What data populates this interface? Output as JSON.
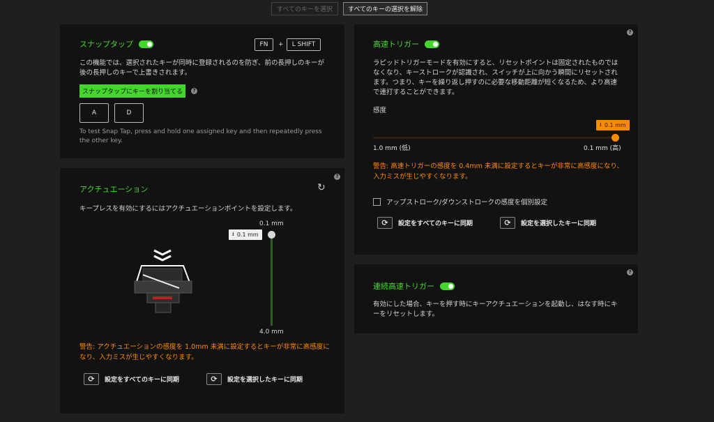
{
  "top": {
    "select_all": "すべてのキーを選択",
    "deselect_all": "すべてのキーの選択を解除"
  },
  "snap_tap": {
    "title": "スナップタップ",
    "key_fn": "FN",
    "plus": "+",
    "key_shift": "L SHIFT",
    "description": "この機能では、選択されたキーが同時に登録されるのを防ぎ、前の長押しのキーが後の長押しのキーで上書きされます。",
    "assign_button": "スナップタップにキーを割り当てる",
    "key_a": "A",
    "key_d": "D",
    "test_hint": "To test Snap Tap, press and hold one assigned key and then repeatedly press the other key."
  },
  "actuation": {
    "title": "アクチュエーション",
    "description": "キープレスを有効にするにはアクチュエーションポイントを設定します。",
    "top_label": "0.1 mm",
    "bottom_label": "4.0 mm",
    "tooltip": "0.1 mm",
    "value_mm": 0.1,
    "warning": "警告: アクチュエーションの感度を 1.0mm 未満に設定するとキーが非常に高感度になり、入力ミスが生じやすくなります。",
    "sync_all": "設定をすべてのキーに同期",
    "sync_selected": "設定を選択したキーに同期"
  },
  "rapid_trigger": {
    "title": "高速トリガー",
    "description": "ラピッドトリガーモードを有効にすると、リセットポイントは固定されたものではなくなり、キーストロークが認識され、スイッチが上に向かう瞬間にリセットされます。つまり、キーを繰り返し押すのに必要な移動距離が短くなるため、より高速で連打することができます。",
    "sensitivity_label": "感度",
    "tooltip": "0.1 mm",
    "value_mm": 0.1,
    "min_label": "1.0 mm (低)",
    "max_label": "0.1 mm (高)",
    "warning": "警告: 高速トリガーの感度を 0.4mm 未満に設定するとキーが非常に高感度になり、入力ミスが生じやすくなります。",
    "checkbox_label": "アップストローク/ダウンストロークの感度を個別設定",
    "sync_all": "設定をすべてのキーに同期",
    "sync_selected": "設定を選択したキーに同期"
  },
  "continuous_rapid": {
    "title": "連続高速トリガー",
    "description": "有効にした場合、キーを押す時にキーアクチュエーションを起動し、はなす時にキーをリセットします。"
  },
  "colors": {
    "accent": "#44d62c",
    "warning": "#ff8a00",
    "slider_track": "#2f1f12"
  }
}
